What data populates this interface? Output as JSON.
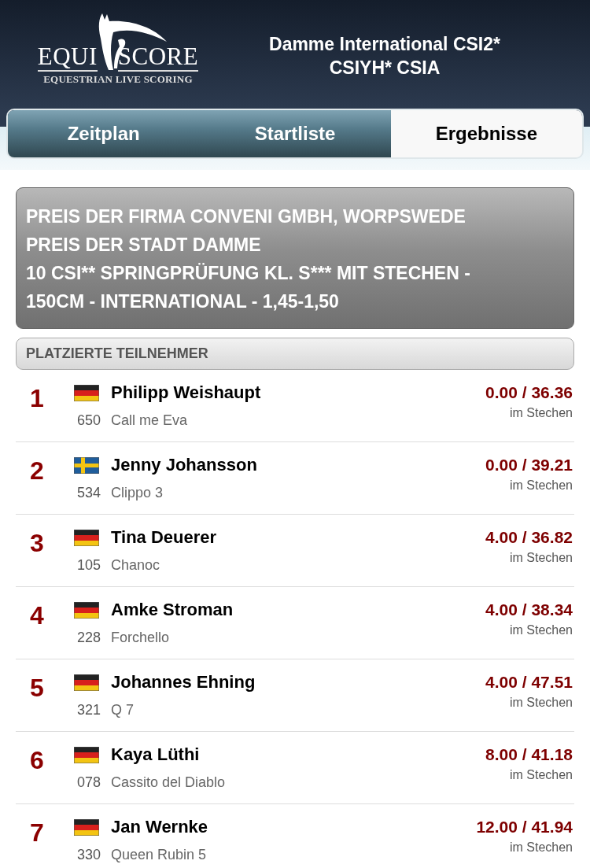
{
  "logo": {
    "left": "EQUI",
    "right": "SCORE",
    "tagline": "EQUESTRIAN LIVE SCORING"
  },
  "event_title": "Damme International CSI2* CSIYH* CSIA",
  "tabs": [
    {
      "label": "Zeitplan",
      "selected": false
    },
    {
      "label": "Startliste",
      "selected": false
    },
    {
      "label": "Ergebnisse",
      "selected": true
    }
  ],
  "competition": {
    "lines": [
      "PREIS DER FIRMA CONVENI GMBH, WORPSWEDE",
      "PREIS DER STADT DAMME",
      "10 CSI** SPRINGPRÜFUNG KL. S*** MIT STECHEN - 150CM - INTERNATIONAL - 1,45-1,50"
    ]
  },
  "section_header": "PLATZIERTE TEILNEHMER",
  "results": [
    {
      "rank": "1",
      "kind": "de",
      "rider": "Philipp Weishaupt",
      "number": "650",
      "horse": "Call me Eva",
      "score": "0.00 / 36.36",
      "round": "im Stechen"
    },
    {
      "rank": "2",
      "kind": "se",
      "rider": "Jenny Johansson",
      "number": "534",
      "horse": "Clippo 3",
      "score": "0.00 / 39.21",
      "round": "im Stechen"
    },
    {
      "rank": "3",
      "kind": "de",
      "rider": "Tina Deuerer",
      "number": "105",
      "horse": "Chanoc",
      "score": "4.00 / 36.82",
      "round": "im Stechen"
    },
    {
      "rank": "4",
      "kind": "de",
      "rider": "Amke Stroman",
      "number": "228",
      "horse": "Forchello",
      "score": "4.00 / 38.34",
      "round": "im Stechen"
    },
    {
      "rank": "5",
      "kind": "de",
      "rider": "Johannes Ehning",
      "number": "321",
      "horse": "Q 7",
      "score": "4.00 / 47.51",
      "round": "im Stechen"
    },
    {
      "rank": "6",
      "kind": "de",
      "rider": "Kaya Lüthi",
      "number": "078",
      "horse": "Cassito del Diablo",
      "score": "8.00 / 41.18",
      "round": "im Stechen"
    },
    {
      "rank": "7",
      "kind": "de",
      "rider": "Jan Wernke",
      "number": "330",
      "horse": "Queen Rubin 5",
      "score": "12.00 / 41.94",
      "round": "im Stechen"
    }
  ]
}
